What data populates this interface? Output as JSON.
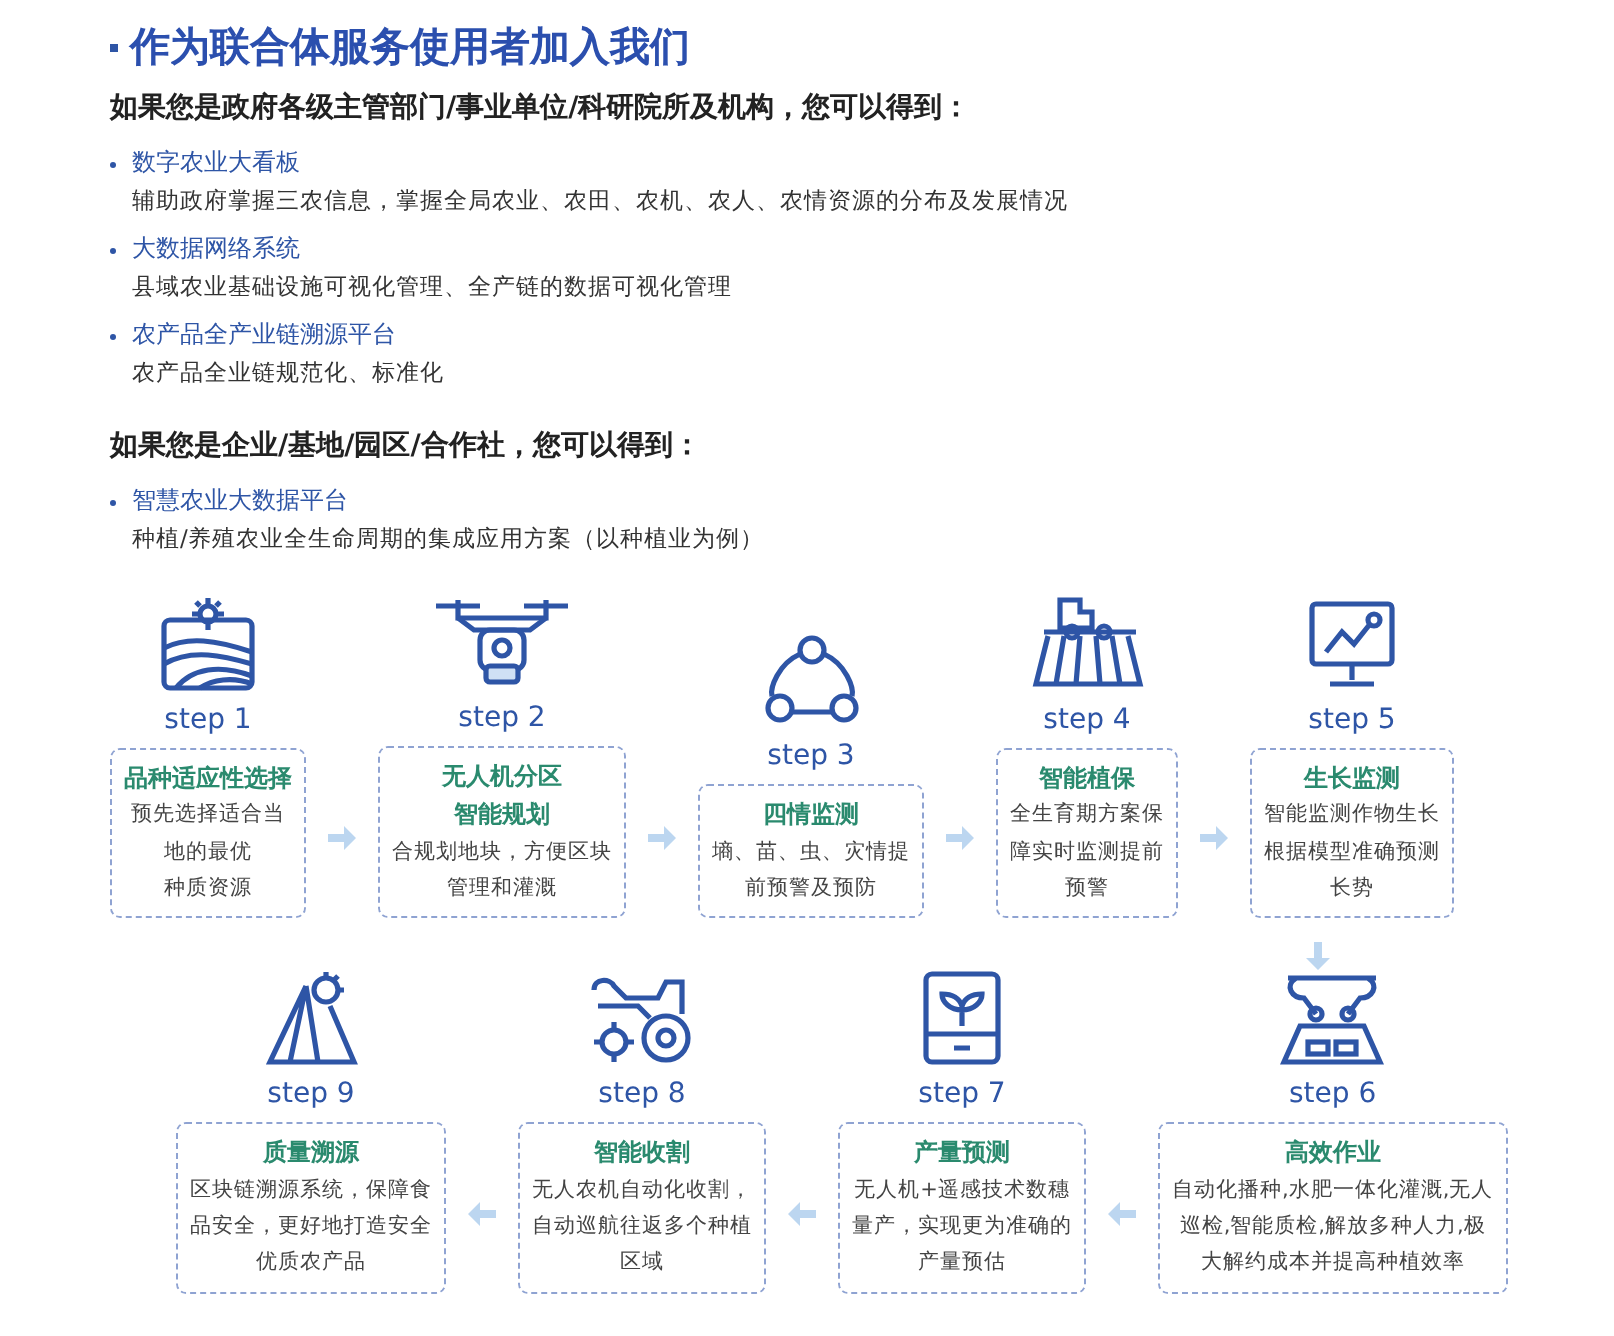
{
  "title": "作为联合体服务使用者加入我们",
  "sections": [
    {
      "heading": "如果您是政府各级主管部门/事业单位/科研院所及机构，您可以得到：",
      "items": [
        {
          "name": "数字农业大看板",
          "desc": "辅助政府掌握三农信息，掌握全局农业、农田、农机、农人、农情资源的分布及发展情况"
        },
        {
          "name": "大数据网络系统",
          "desc": "县域农业基础设施可视化管理、全产链的数据可视化管理"
        },
        {
          "name": "农产品全产业链溯源平台",
          "desc": "农产品全业链规范化、标准化"
        }
      ]
    },
    {
      "heading": "如果您是企业/基地/园区/合作社，您可以得到：",
      "items": [
        {
          "name": "智慧农业大数据平台",
          "desc": "种植/养殖农业全生命周期的集成应用方案（以种植业为例）"
        }
      ]
    }
  ],
  "row_1": [
    {
      "step": "step 1",
      "title_lines": [
        "品种适应性选择"
      ],
      "desc_lines": [
        "预先选择适合当",
        "地的最优",
        "种质资源"
      ]
    },
    {
      "step": "step 2",
      "title_lines": [
        "无人机分区",
        "智能规划"
      ],
      "desc_lines": [
        "合规划地块，方便区块",
        "管理和灌溉"
      ]
    },
    {
      "step": "step 3",
      "title_lines": [
        "四情监测"
      ],
      "desc_lines": [
        "墒、苗、虫、灾情提",
        "前预警及预防"
      ]
    },
    {
      "step": "step 4",
      "title_lines": [
        "智能植保"
      ],
      "desc_lines": [
        "全生育期方案保",
        "障实时监测提前",
        "预警"
      ]
    },
    {
      "step": "step 5",
      "title_lines": [
        "生长监测"
      ],
      "desc_lines": [
        "智能监测作物生长",
        "根据模型准确预测",
        "长势"
      ]
    }
  ],
  "row_2": [
    {
      "step": "step 9",
      "title_lines": [
        "质量溯源"
      ],
      "desc_lines": [
        "区块链溯源系统，保障食",
        "品安全，更好地打造安全",
        "优质农产品"
      ]
    },
    {
      "step": "step 8",
      "title_lines": [
        "智能收割"
      ],
      "desc_lines": [
        "无人农机自动化收割，",
        "自动巡航往返多个种植",
        "区域"
      ]
    },
    {
      "step": "step 7",
      "title_lines": [
        "产量预测"
      ],
      "desc_lines": [
        "无人机+遥感技术数穗",
        "量产，实现更为准确的",
        "产量预估"
      ]
    },
    {
      "step": "step 6",
      "title_lines": [
        "高效作业"
      ],
      "desc_lines": [
        "自动化播种,水肥一体化灌溉,无人",
        "巡检,智能质检,解放多种人力,极",
        "大解约成本并提高种植效率"
      ]
    }
  ]
}
